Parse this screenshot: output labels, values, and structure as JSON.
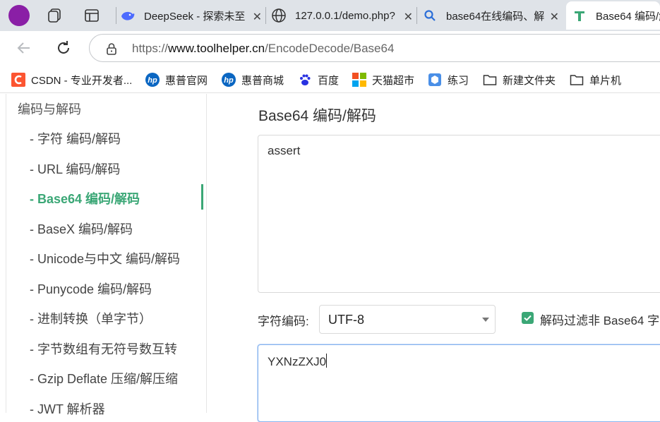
{
  "browser": {
    "tabs": [
      {
        "title": "DeepSeek - 探索未至",
        "icon": "deepseek-whale-icon"
      },
      {
        "title": "127.0.0.1/demo.php?",
        "icon": "globe-icon"
      },
      {
        "title": "base64在线编码、解",
        "icon": "search-icon"
      },
      {
        "title": "Base64 编码/解",
        "icon": "toolhelper-icon"
      }
    ],
    "close_glyph": "✕",
    "url_prefix": "https://",
    "url_host": "www.toolhelper.cn",
    "url_path": "/EncodeDecode/Base64"
  },
  "bookmarks": [
    {
      "label": "CSDN - 专业开发者...",
      "icon": "csdn-icon"
    },
    {
      "label": "惠普官网",
      "icon": "hp-icon"
    },
    {
      "label": "惠普商城",
      "icon": "hp-icon"
    },
    {
      "label": "百度",
      "icon": "baidu-paw-icon"
    },
    {
      "label": "天猫超市",
      "icon": "microsoft-grid-icon"
    },
    {
      "label": "练习",
      "icon": "cube-icon"
    },
    {
      "label": "新建文件夹",
      "icon": "folder-icon"
    },
    {
      "label": "单片机",
      "icon": "folder-icon"
    }
  ],
  "sidebar": {
    "heading": "编码与解码",
    "items": [
      {
        "label": "- 字符  编码/解码"
      },
      {
        "label": "- URL  编码/解码"
      },
      {
        "label": "- Base64  编码/解码"
      },
      {
        "label": "- BaseX  编码/解码"
      },
      {
        "label": "- Unicode与中文  编码/解码"
      },
      {
        "label": "- Punycode  编码/解码"
      },
      {
        "label": "- 进制转换（单字节）"
      },
      {
        "label": "- 字节数组有无符号数互转"
      },
      {
        "label": "- Gzip Deflate 压缩/解压缩"
      },
      {
        "label": "- JWT 解析器"
      }
    ],
    "active_index": 2
  },
  "main": {
    "title": "Base64 编码/解码",
    "input_text": "assert",
    "charset_label": "字符编码:",
    "charset_value": "UTF-8",
    "filter_label": "解码过滤非 Base64 字",
    "filter_checked": true,
    "output_text": "YXNzZXJ0"
  },
  "colors": {
    "accent_green": "#3ba776",
    "profile_purple": "#8a1fa6"
  }
}
